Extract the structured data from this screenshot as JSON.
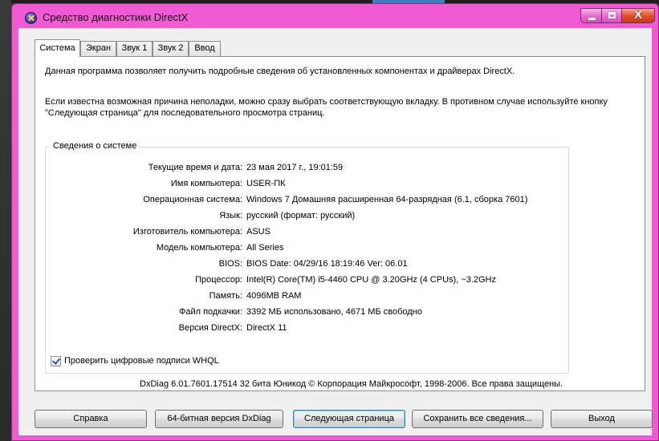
{
  "window": {
    "title": "Средство диагностики DirectX",
    "close_glyph": "X",
    "icon": "directx-x-icon"
  },
  "tabs": [
    {
      "label": "Система",
      "active": true
    },
    {
      "label": "Экран",
      "active": false
    },
    {
      "label": "Звук 1",
      "active": false
    },
    {
      "label": "Звук 2",
      "active": false
    },
    {
      "label": "Ввод",
      "active": false
    }
  ],
  "content": {
    "intro": "Данная программа позволяет получить подробные сведения об установленных компонентах и драйверах DirectX.",
    "hint": "Если известна возможная причина неполадки, можно сразу выбрать соответствующую вкладку. В противном случае используйте кнопку \"Следующая страница\" для последовательного просмотра страниц.",
    "group_title": "Сведения о системе",
    "rows": [
      {
        "label": "Текущие время и дата:",
        "value": "23 мая 2017 г., 19:01:59"
      },
      {
        "label": "Имя компьютера:",
        "value": "USER-ПК"
      },
      {
        "label": "Операционная система:",
        "value": "Windows 7 Домашняя расширенная 64-разрядная (6.1, сборка 7601)"
      },
      {
        "label": "Язык:",
        "value": "русский (формат: русский)"
      },
      {
        "label": "Изготовитель компьютера:",
        "value": "ASUS"
      },
      {
        "label": "Модель компьютера:",
        "value": "All Series"
      },
      {
        "label": "BIOS:",
        "value": "BIOS Date: 04/29/16 18:19:46 Ver: 06.01"
      },
      {
        "label": "Процессор:",
        "value": "Intel(R) Core(TM) i5-4460  CPU @ 3.20GHz (4 CPUs), ~3.2GHz"
      },
      {
        "label": "Память:",
        "value": "4096MB RAM"
      },
      {
        "label": "Файл подкачки:",
        "value": "3392 МБ использовано, 4671 МБ свободно"
      },
      {
        "label": "Версия DirectX:",
        "value": "DirectX 11"
      }
    ],
    "whql_label": "Проверить цифровые подписи WHQL",
    "whql_checked": true,
    "copyright": "DxDiag 6.01.7601.17514 32 бита Юникод  © Корпорация Майкрософт, 1998-2006.  Все права защищены."
  },
  "buttons": {
    "help": "Справка",
    "dxdiag64": "64-битная версия DxDiag",
    "next_page": "Следующая страница",
    "save_all": "Сохранить все сведения...",
    "exit": "Выход"
  }
}
